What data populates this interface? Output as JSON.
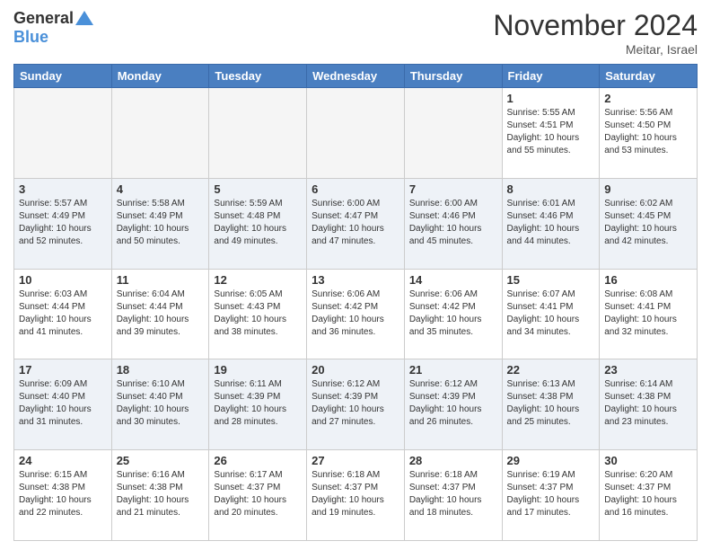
{
  "logo": {
    "general": "General",
    "blue": "Blue"
  },
  "title": "November 2024",
  "location": "Meitar, Israel",
  "days_of_week": [
    "Sunday",
    "Monday",
    "Tuesday",
    "Wednesday",
    "Thursday",
    "Friday",
    "Saturday"
  ],
  "weeks": [
    {
      "days": [
        {
          "number": "",
          "info": ""
        },
        {
          "number": "",
          "info": ""
        },
        {
          "number": "",
          "info": ""
        },
        {
          "number": "",
          "info": ""
        },
        {
          "number": "",
          "info": ""
        },
        {
          "number": "1",
          "info": "Sunrise: 5:55 AM\nSunset: 4:51 PM\nDaylight: 10 hours\nand 55 minutes."
        },
        {
          "number": "2",
          "info": "Sunrise: 5:56 AM\nSunset: 4:50 PM\nDaylight: 10 hours\nand 53 minutes."
        }
      ]
    },
    {
      "days": [
        {
          "number": "3",
          "info": "Sunrise: 5:57 AM\nSunset: 4:49 PM\nDaylight: 10 hours\nand 52 minutes."
        },
        {
          "number": "4",
          "info": "Sunrise: 5:58 AM\nSunset: 4:49 PM\nDaylight: 10 hours\nand 50 minutes."
        },
        {
          "number": "5",
          "info": "Sunrise: 5:59 AM\nSunset: 4:48 PM\nDaylight: 10 hours\nand 49 minutes."
        },
        {
          "number": "6",
          "info": "Sunrise: 6:00 AM\nSunset: 4:47 PM\nDaylight: 10 hours\nand 47 minutes."
        },
        {
          "number": "7",
          "info": "Sunrise: 6:00 AM\nSunset: 4:46 PM\nDaylight: 10 hours\nand 45 minutes."
        },
        {
          "number": "8",
          "info": "Sunrise: 6:01 AM\nSunset: 4:46 PM\nDaylight: 10 hours\nand 44 minutes."
        },
        {
          "number": "9",
          "info": "Sunrise: 6:02 AM\nSunset: 4:45 PM\nDaylight: 10 hours\nand 42 minutes."
        }
      ]
    },
    {
      "days": [
        {
          "number": "10",
          "info": "Sunrise: 6:03 AM\nSunset: 4:44 PM\nDaylight: 10 hours\nand 41 minutes."
        },
        {
          "number": "11",
          "info": "Sunrise: 6:04 AM\nSunset: 4:44 PM\nDaylight: 10 hours\nand 39 minutes."
        },
        {
          "number": "12",
          "info": "Sunrise: 6:05 AM\nSunset: 4:43 PM\nDaylight: 10 hours\nand 38 minutes."
        },
        {
          "number": "13",
          "info": "Sunrise: 6:06 AM\nSunset: 4:42 PM\nDaylight: 10 hours\nand 36 minutes."
        },
        {
          "number": "14",
          "info": "Sunrise: 6:06 AM\nSunset: 4:42 PM\nDaylight: 10 hours\nand 35 minutes."
        },
        {
          "number": "15",
          "info": "Sunrise: 6:07 AM\nSunset: 4:41 PM\nDaylight: 10 hours\nand 34 minutes."
        },
        {
          "number": "16",
          "info": "Sunrise: 6:08 AM\nSunset: 4:41 PM\nDaylight: 10 hours\nand 32 minutes."
        }
      ]
    },
    {
      "days": [
        {
          "number": "17",
          "info": "Sunrise: 6:09 AM\nSunset: 4:40 PM\nDaylight: 10 hours\nand 31 minutes."
        },
        {
          "number": "18",
          "info": "Sunrise: 6:10 AM\nSunset: 4:40 PM\nDaylight: 10 hours\nand 30 minutes."
        },
        {
          "number": "19",
          "info": "Sunrise: 6:11 AM\nSunset: 4:39 PM\nDaylight: 10 hours\nand 28 minutes."
        },
        {
          "number": "20",
          "info": "Sunrise: 6:12 AM\nSunset: 4:39 PM\nDaylight: 10 hours\nand 27 minutes."
        },
        {
          "number": "21",
          "info": "Sunrise: 6:12 AM\nSunset: 4:39 PM\nDaylight: 10 hours\nand 26 minutes."
        },
        {
          "number": "22",
          "info": "Sunrise: 6:13 AM\nSunset: 4:38 PM\nDaylight: 10 hours\nand 25 minutes."
        },
        {
          "number": "23",
          "info": "Sunrise: 6:14 AM\nSunset: 4:38 PM\nDaylight: 10 hours\nand 23 minutes."
        }
      ]
    },
    {
      "days": [
        {
          "number": "24",
          "info": "Sunrise: 6:15 AM\nSunset: 4:38 PM\nDaylight: 10 hours\nand 22 minutes."
        },
        {
          "number": "25",
          "info": "Sunrise: 6:16 AM\nSunset: 4:38 PM\nDaylight: 10 hours\nand 21 minutes."
        },
        {
          "number": "26",
          "info": "Sunrise: 6:17 AM\nSunset: 4:37 PM\nDaylight: 10 hours\nand 20 minutes."
        },
        {
          "number": "27",
          "info": "Sunrise: 6:18 AM\nSunset: 4:37 PM\nDaylight: 10 hours\nand 19 minutes."
        },
        {
          "number": "28",
          "info": "Sunrise: 6:18 AM\nSunset: 4:37 PM\nDaylight: 10 hours\nand 18 minutes."
        },
        {
          "number": "29",
          "info": "Sunrise: 6:19 AM\nSunset: 4:37 PM\nDaylight: 10 hours\nand 17 minutes."
        },
        {
          "number": "30",
          "info": "Sunrise: 6:20 AM\nSunset: 4:37 PM\nDaylight: 10 hours\nand 16 minutes."
        }
      ]
    }
  ]
}
